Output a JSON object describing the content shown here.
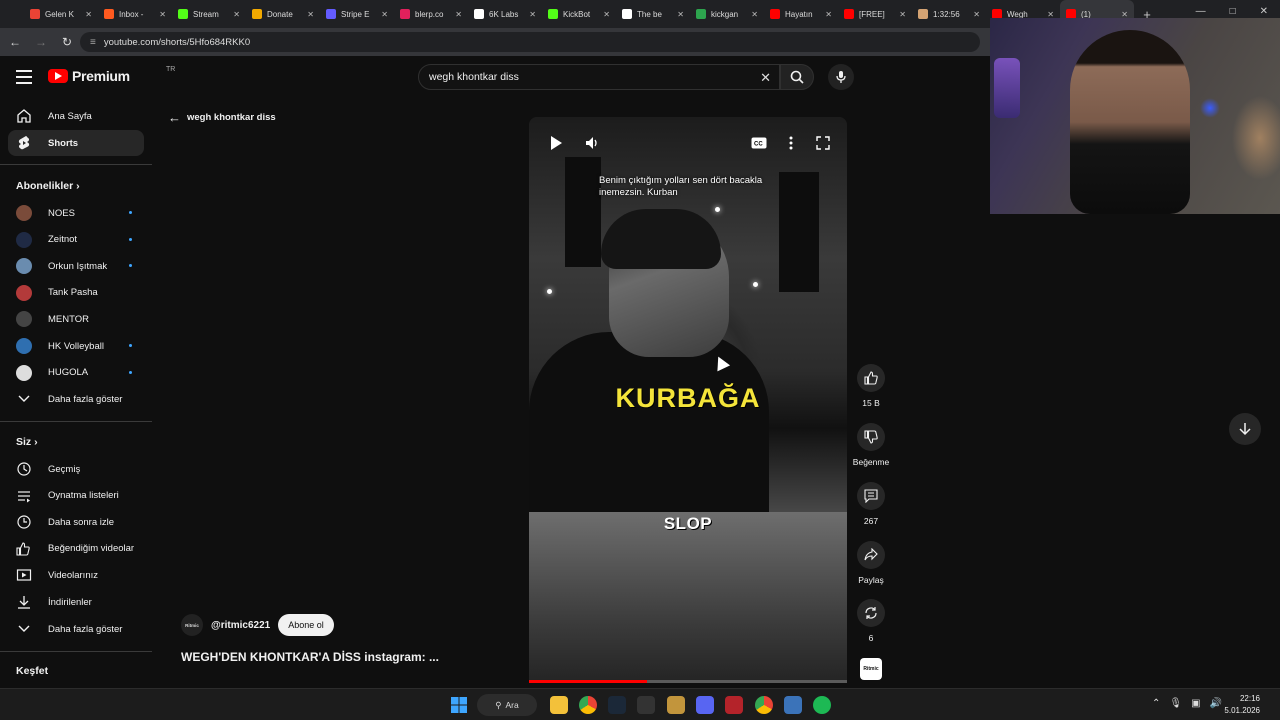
{
  "browser": {
    "tabs": [
      {
        "label": "Gelen K",
        "color": "#ea4335"
      },
      {
        "label": "Inbox -",
        "color": "#ff5a1f"
      },
      {
        "label": "Stream",
        "color": "#53fc18"
      },
      {
        "label": "Donate",
        "color": "#f2a900"
      },
      {
        "label": "Stripe E",
        "color": "#635bff"
      },
      {
        "label": "blerp.co",
        "color": "#e2205c"
      },
      {
        "label": "6K Labs",
        "color": "#ffffff"
      },
      {
        "label": "KickBot",
        "color": "#53fc18"
      },
      {
        "label": "The be",
        "color": "#ffffff"
      },
      {
        "label": "kickgan",
        "color": "#2da44e"
      },
      {
        "label": "Hayatın",
        "color": "#ff0000"
      },
      {
        "label": "[FREE]",
        "color": "#ff0000"
      },
      {
        "label": "1:32:56",
        "color": "#d4a373"
      },
      {
        "label": "Wegh",
        "color": "#ff0000"
      },
      {
        "label": "(1)",
        "color": "#ff0000"
      }
    ],
    "new_tab": "+",
    "url": "youtube.com/shorts/5Hfo684RKK0"
  },
  "masthead": {
    "logo": "Premium",
    "country": "TR",
    "search_value": "wegh khontkar diss"
  },
  "sidebar": {
    "main": [
      {
        "label": "Ana Sayfa",
        "icon": "home-icon"
      },
      {
        "label": "Shorts",
        "icon": "shorts-icon"
      }
    ],
    "subs_heading": "Abonelikler",
    "subs": [
      {
        "label": "NOES",
        "color": "#7a4b3a",
        "dot": true
      },
      {
        "label": "Zeitnot",
        "color": "#1f2a44",
        "dot": true
      },
      {
        "label": "Orkun Işıtmak",
        "color": "#6a8caf",
        "dot": true
      },
      {
        "label": "Tank Pasha",
        "color": "#b33a3a",
        "dot": false
      },
      {
        "label": "MENTOR",
        "color": "#444444",
        "dot": false
      },
      {
        "label": "HK Volleyball",
        "color": "#2f6fb0",
        "dot": true
      },
      {
        "label": "HUGOLA",
        "color": "#dddddd",
        "dot": true
      }
    ],
    "subs_more": "Daha fazla göster",
    "you_heading": "Siz",
    "you": [
      {
        "label": "Geçmiş",
        "icon": "history-icon"
      },
      {
        "label": "Oynatma listeleri",
        "icon": "playlists-icon"
      },
      {
        "label": "Daha sonra izle",
        "icon": "watch-later-icon"
      },
      {
        "label": "Beğendiğim videolar",
        "icon": "liked-videos-icon"
      },
      {
        "label": "Videolarınız",
        "icon": "your-videos-icon"
      },
      {
        "label": "İndirilenler",
        "icon": "downloads-icon"
      }
    ],
    "you_more": "Daha fazla göster",
    "explore_heading": "Keşfet"
  },
  "shorts": {
    "back_label": "wegh khontkar diss",
    "caption": "Benim çıktığım yolları sen dört bacakla inemezsin. Kurban",
    "overlay_1": "KURBAĞA",
    "overlay_2": "SLOP",
    "progress": 0.37,
    "actions": {
      "likes": "15 B",
      "dislike": "Beğenme",
      "comments": "267",
      "share": "Paylaş",
      "remix": "6"
    },
    "channel_handle": "@ritmic6221",
    "channel_avatar_text": "Ritmic",
    "subscribe": "Abone ol",
    "title": "WEGH'DEN KHONTKAR'A DİSS   instagram: ..."
  },
  "taskbar": {
    "search": "Ara",
    "time": "22:16",
    "date": "5.01.2026"
  }
}
